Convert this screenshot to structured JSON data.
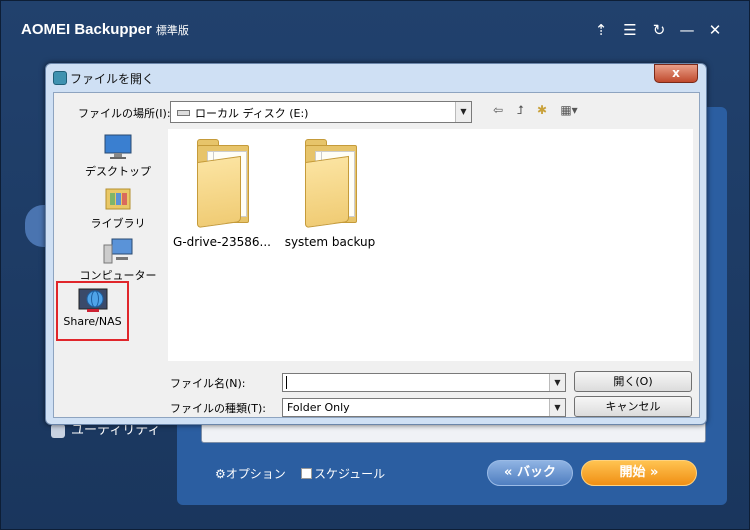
{
  "app": {
    "title": "AOMEI Backupper",
    "edition": "標準版",
    "options_label": "オプション",
    "schedule_label": "スケジュール",
    "back_label": "« バック",
    "start_label": "開始  »",
    "ghost_item_label": "ユーティリティ"
  },
  "dialog": {
    "title": "ファイルを開く",
    "close_label": "x",
    "location_label": "ファイルの場所(I):",
    "location_value": "ローカル ディスク (E:)",
    "places": [
      {
        "label": "デスクトップ",
        "icon": "desktop-icon"
      },
      {
        "label": "ライブラリ",
        "icon": "library-icon"
      },
      {
        "label": "コンピューター",
        "icon": "computer-icon"
      },
      {
        "label": "Share/NAS",
        "icon": "network-globe-icon"
      }
    ],
    "files": [
      {
        "name": "G-drive-23586...",
        "icon": "folder-icon"
      },
      {
        "name": "system backup",
        "icon": "folder-icon"
      }
    ],
    "filename_label": "ファイル名(N):",
    "filename_value": "",
    "filetype_label": "ファイルの種類(T):",
    "filetype_value": "Folder Only",
    "open_label": "開く(O)",
    "cancel_label": "キャンセル"
  },
  "colors": {
    "app_bg": "#21416d",
    "panel": "#2b5ea1",
    "start_button": "#f5a623",
    "back_button": "#6f9bd5",
    "highlight_border": "#e0262b"
  }
}
